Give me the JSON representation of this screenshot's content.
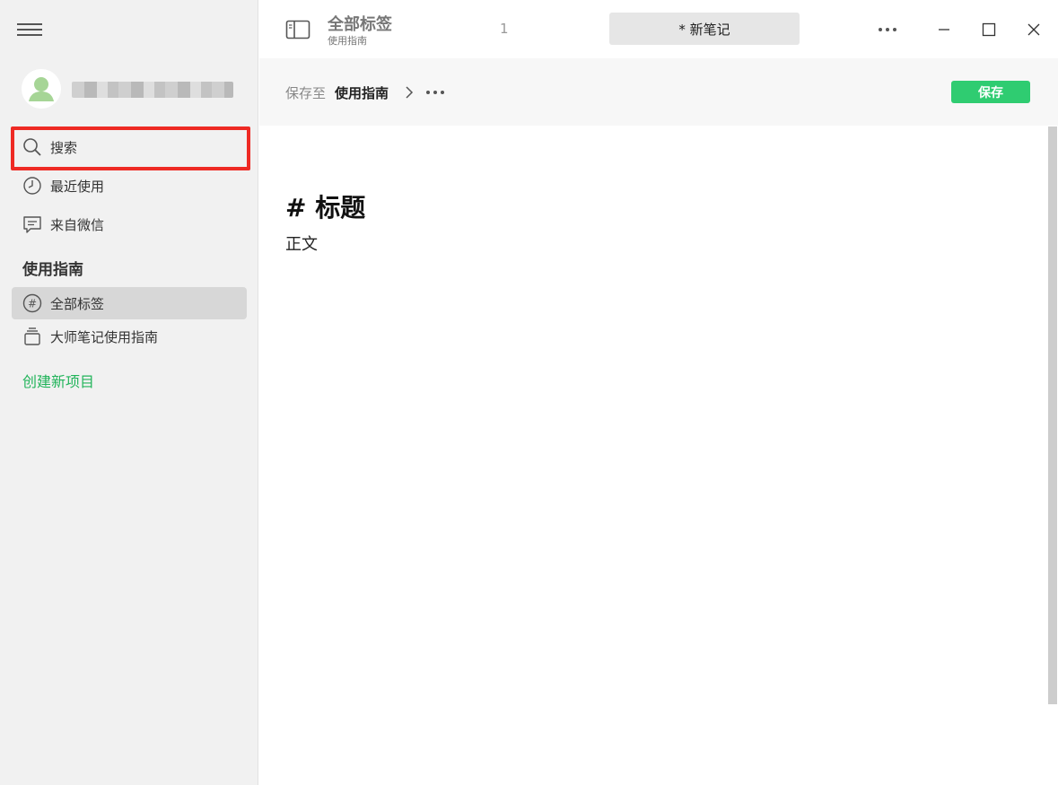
{
  "sidebar": {
    "menu_icon": "hamburger-icon",
    "user": {
      "avatar_icon": "user-avatar-icon"
    },
    "search_label": "搜索",
    "nav_items": [
      {
        "label": "最近使用",
        "icon": "clock-icon"
      },
      {
        "label": "来自微信",
        "icon": "chat-icon"
      }
    ],
    "section_title": "使用指南",
    "section_items": [
      {
        "label": "全部标签",
        "icon": "hash-icon",
        "active": true
      },
      {
        "label": "大师笔记使用指南",
        "icon": "stack-icon",
        "active": false
      }
    ],
    "create_label": "创建新项目"
  },
  "titlebar": {
    "title": "全部标签",
    "subtitle": "使用指南",
    "count": "1",
    "tab_label": "* 新笔记"
  },
  "toolbar": {
    "save_to_label": "保存至",
    "save_target": "使用指南",
    "save_button": "保存"
  },
  "editor": {
    "heading": "# 标题",
    "body": "正文"
  },
  "colors": {
    "accent_green": "#2fcc71",
    "link_green": "#21b45a",
    "highlight_red": "#ee2a24",
    "sidebar_bg": "#f1f1f1"
  }
}
